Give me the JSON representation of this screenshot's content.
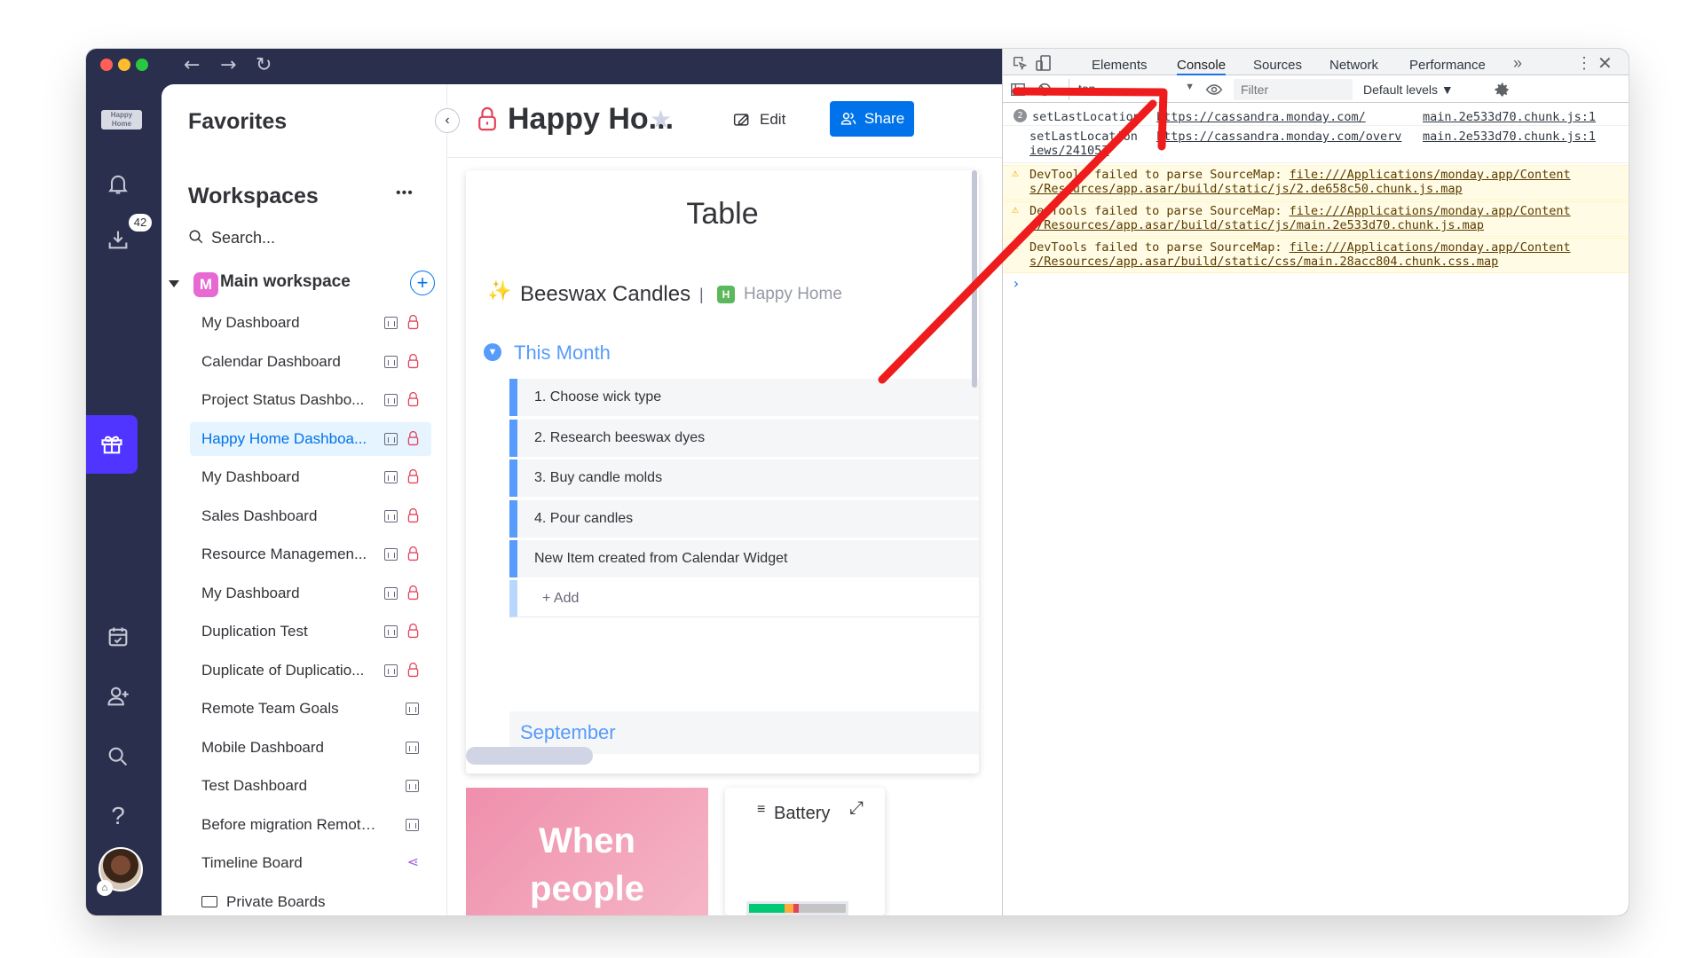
{
  "rail": {
    "badge": "42",
    "logo_text": "Happy Home"
  },
  "sidebar": {
    "favorites_title": "Favorites",
    "workspaces_title": "Workspaces",
    "more_label": "•••",
    "search_placeholder": "Search...",
    "workspace_initial": "M",
    "workspace_name": "Main workspace",
    "items": [
      {
        "label": "My Dashboard"
      },
      {
        "label": "Calendar Dashboard"
      },
      {
        "label": "Project Status Dashbo..."
      },
      {
        "label": "Happy Home Dashboa..."
      },
      {
        "label": "My Dashboard"
      },
      {
        "label": "Sales Dashboard"
      },
      {
        "label": "Resource Managemen..."
      },
      {
        "label": "My Dashboard"
      },
      {
        "label": "Duplication Test"
      },
      {
        "label": "Duplicate of Duplicatio..."
      },
      {
        "label": "Remote Team Goals"
      },
      {
        "label": "Mobile Dashboard"
      },
      {
        "label": "Test Dashboard"
      },
      {
        "label": "Before migration Remote ..."
      },
      {
        "label": "Timeline Board"
      },
      {
        "label": "Private Boards"
      }
    ]
  },
  "header": {
    "title": "Happy Ho...",
    "edit_label": "Edit",
    "share_label": "Share"
  },
  "widget": {
    "title": "Table",
    "board_name": "Beeswax Candles",
    "separator": "|",
    "workspace_initial": "H",
    "workspace_name": "Happy Home",
    "group_this_month": "This Month",
    "rows": [
      "1. Choose wick type",
      "2. Research beeswax dyes",
      "3. Buy candle molds",
      "4. Pour candles",
      "New Item created from Calendar Widget"
    ],
    "add_label": "+ Add",
    "group_september": "September"
  },
  "bottom_widgets": {
    "quote_line1": "When",
    "quote_line2": "people",
    "battery_title": "Battery"
  },
  "devtools": {
    "tabs": [
      "Elements",
      "Console",
      "Sources",
      "Network",
      "Performance"
    ],
    "active_tab": "Console",
    "more_tabs": "»",
    "context": "top",
    "filter_placeholder": "Filter",
    "levels": "Default levels ▼",
    "log": [
      {
        "count": "2",
        "msg": "setLastLocation",
        "url": "https://cassandra.monday.com/",
        "src": "main.2e533d70.chunk.js:1"
      },
      {
        "msg": "setLastLocation",
        "url": "https://cassandra.monday.com/overv",
        "url2": "iews/241057",
        "src": "main.2e533d70.chunk.js:1"
      }
    ],
    "warnings": [
      {
        "prefix": "DevTools failed to parse SourceMap: ",
        "url1": "file:///Applications/monday.app/Content",
        "url2": "s/Resources/app.asar/build/static/js/2.de658c50.chunk.js.map"
      },
      {
        "prefix": "DevTools failed to parse SourceMap: ",
        "url1": "file:///Applications/monday.app/Content",
        "url2": "s/Resources/app.asar/build/static/js/main.2e533d70.chunk.js.map"
      },
      {
        "prefix": "DevTools failed to parse SourceMap: ",
        "url1": "file:///Applications/monday.app/Content",
        "url2": "s/Resources/app.asar/build/static/css/main.28acc804.chunk.css.map"
      }
    ],
    "prompt": "›"
  },
  "colors": {
    "accent": "#0073ea",
    "rail": "#292f4c",
    "group": "#579bfc",
    "arrow": "#ee1c1c",
    "lock": "#e2445c"
  }
}
